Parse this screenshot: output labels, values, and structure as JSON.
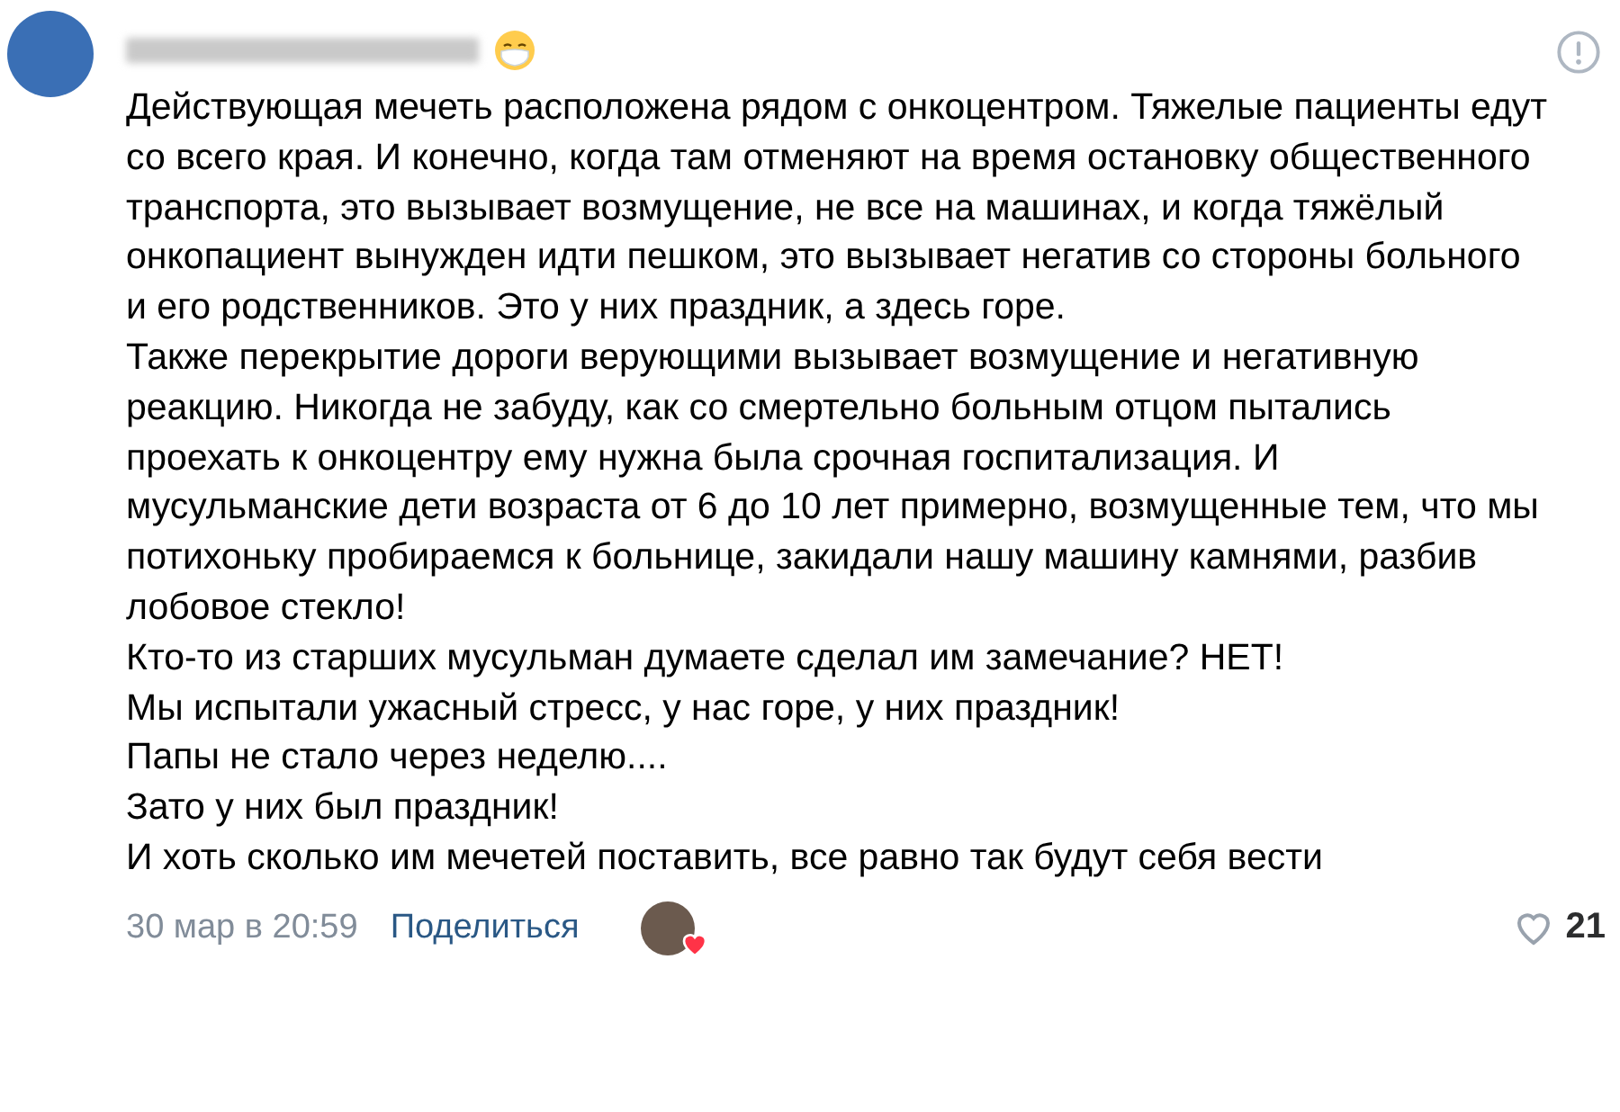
{
  "comment": {
    "paragraphs": [
      "Действующая мечеть расположена рядом с онкоцентром. Тяжелые пациенты едут со всего края. И конечно, когда там отменяют на время остановку общественного транспорта, это вызывает возмущение, не все на машинах, и когда тяжёлый онкопациент вынужден идти пешком, это вызывает негатив со стороны больного и его родственников. Это у них праздник, а здесь горе.",
      "Также перекрытие дороги верующими вызывает возмущение и негативную реакцию. Никогда не забуду, как со смертельно больным отцом пытались проехать к онкоцентру ему нужна была срочная госпитализация. И мусульманские дети возраста от 6 до 10 лет примерно, возмущенные тем, что мы потихоньку пробираемся к больнице, закидали нашу машину камнями, разбив лобовое стекло!",
      "Кто-то из старших мусульман думаете сделал им замечание? НЕТ!",
      "Мы испытали ужасный стресс, у нас горе, у них праздник!",
      "Папы не стало через неделю....",
      "Зато у них был праздник!",
      "И хоть сколько им мечетей поставить, все равно так будут себя вести"
    ],
    "date": "30 мар в 20:59",
    "share": "Поделиться",
    "liked": false,
    "likes": "21"
  }
}
